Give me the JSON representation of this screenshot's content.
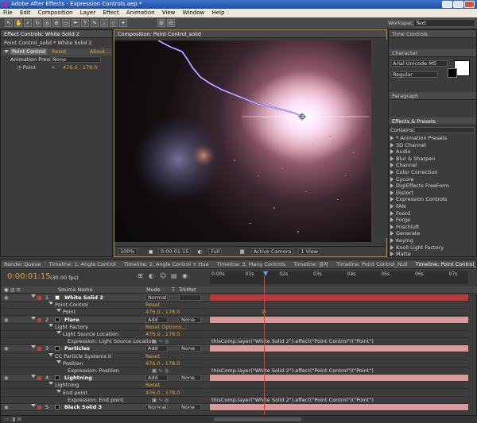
{
  "window": {
    "title": "Adobe After Effects - Expression Controls.aep *"
  },
  "menu": [
    "File",
    "Edit",
    "Composition",
    "Layer",
    "Effect",
    "Animation",
    "View",
    "Window",
    "Help"
  ],
  "workspace": {
    "label": "Workspace:",
    "value": "Text"
  },
  "effect_controls": {
    "tab": "Effect Controls: White Solid 2",
    "breadcrumb": "Point Control_solid * White Solid 2",
    "effect_name": "Point Control",
    "reset": "Reset",
    "about": "About...",
    "preset_label": "Animation Presets:",
    "preset_value": "None",
    "point_label": "Point",
    "point_value": "476.0 , 178.0"
  },
  "composition": {
    "tab": "Composition: Point Control_solid",
    "footer": {
      "zoom": "100%",
      "time": "0:00:01:15",
      "resolution": "Full",
      "camera": "Active Camera",
      "view": "1 View"
    }
  },
  "right_panels": {
    "time_controls": "Time Controls",
    "character": "Character",
    "font": "Arial Unicode MS",
    "font_style": "Regular",
    "paragraph": "Paragraph",
    "effects_presets": "Effects & Presets",
    "contains_label": "Contains:",
    "effects_list": [
      "* Animation Presets",
      "3D Channel",
      "Audio",
      "Blur & Sharpen",
      "Channel",
      "Color Correction",
      "Cycore",
      "DigiEffects FreeForm",
      "Distort",
      "Expression Controls",
      "FAN",
      "Foord",
      "Forge",
      "Frischluft",
      "Generate",
      "Keying",
      "Knoll Light Factory",
      "Matte"
    ]
  },
  "timeline": {
    "tabs": [
      "Render Queue",
      "Timeline: 1. Angle Control",
      "Timeline: 2. Angle Control + Hue",
      "Timeline: 3. Many Controls",
      "Timeline: 글자",
      "Timeline: Point Control_Null",
      "Timeline: Point Control_solid"
    ],
    "current_time": "0:00:01:15",
    "fps": "(30.00 fps)",
    "col_source": "Source Name",
    "col_mode": "Mode",
    "col_t": "T",
    "col_trkmat": "TrkMat",
    "ruler": [
      "0:00s",
      "01s",
      "02s",
      "03s",
      "04s",
      "05s",
      "06s",
      "07s"
    ],
    "rows": [
      {
        "kind": "layer",
        "num": "1",
        "name": "White Solid 2",
        "mode": "Normal",
        "trkmat": ""
      },
      {
        "kind": "effect",
        "name": "Point Control",
        "extra": "Reset"
      },
      {
        "kind": "prop",
        "name": "Point",
        "value": "476.0 , 178.0"
      },
      {
        "kind": "layer",
        "num": "2",
        "name": "Flare",
        "mode": "Add",
        "trkmat": "None"
      },
      {
        "kind": "effect",
        "name": "Light Factory",
        "extra": "Reset  Options..."
      },
      {
        "kind": "prop",
        "name": "Light Source Location",
        "value": "476.0 , 178.0"
      },
      {
        "kind": "expr",
        "name": "Expression: Light Source Location",
        "expr": "thisComp.layer(\"White Solid 2\").effect(\"Point Control\")(\"Point\")"
      },
      {
        "kind": "layer",
        "num": "3",
        "name": "Particles",
        "mode": "Add",
        "trkmat": "None"
      },
      {
        "kind": "effect",
        "name": "CC Particle Systems II",
        "extra": "Reset"
      },
      {
        "kind": "prop",
        "name": "Position",
        "value": "476.0 , 178.0"
      },
      {
        "kind": "expr",
        "name": "Expression: Position",
        "expr": "thisComp.layer(\"White Solid 2\").effect(\"Point Control\")(\"Point\")"
      },
      {
        "kind": "layer",
        "num": "4",
        "name": "Lightning",
        "mode": "Add",
        "trkmat": "None"
      },
      {
        "kind": "effect",
        "name": "Lightning",
        "extra": "Reset"
      },
      {
        "kind": "prop",
        "name": "End point",
        "value": "476.0 , 178.0"
      },
      {
        "kind": "expr",
        "name": "Expression: End point",
        "expr": "thisComp.layer(\"White Solid 2\").effect(\"Point Control\")(\"Point\")"
      },
      {
        "kind": "layer",
        "num": "5",
        "name": "Black Solid 3",
        "mode": "Normal",
        "trkmat": "None"
      }
    ]
  },
  "colors": {
    "accent": "#e6a33a",
    "lightning": "#8877ff",
    "track": "#d99a9a",
    "playhead": "#ff3030"
  }
}
